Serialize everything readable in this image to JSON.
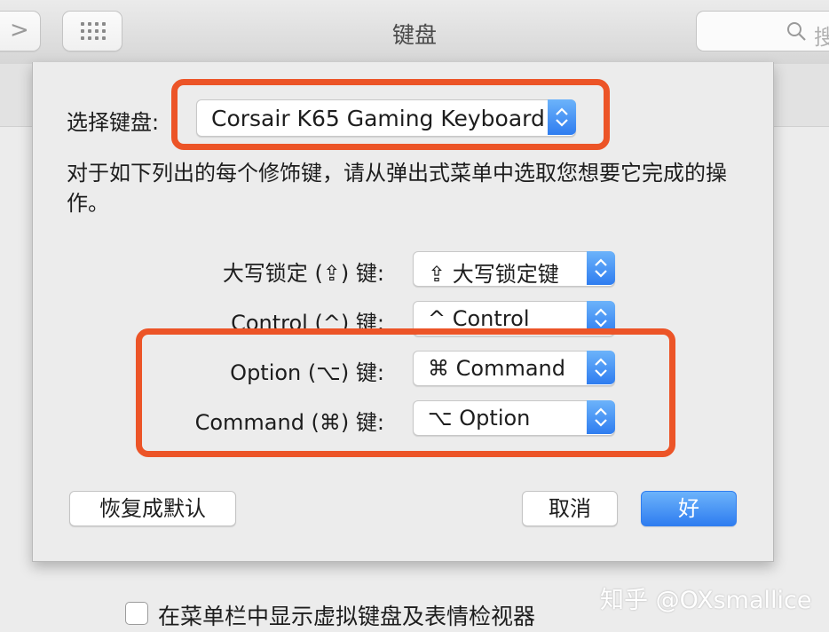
{
  "window": {
    "title": "键盘",
    "search_placeholder": "搜"
  },
  "sheet": {
    "keyboard_label": "选择键盘:",
    "keyboard_value": "Corsair K65 Gaming Keyboard",
    "description": "对于如下列出的每个修饰键，请从弹出式菜单中选取您想要它完成的操作。",
    "modifiers": [
      {
        "label": "大写锁定 (⇪) 键:",
        "value": "⇪ 大写锁定键"
      },
      {
        "label": "Control (^) 键:",
        "value": "^ Control"
      },
      {
        "label": "Option (⌥) 键:",
        "value": "⌘ Command"
      },
      {
        "label": "Command (⌘) 键:",
        "value": "⌥ Option"
      }
    ],
    "restore_button": "恢复成默认",
    "cancel_button": "取消",
    "ok_button": "好"
  },
  "footer": {
    "checkbox_label": "在菜单栏中显示虚拟键盘及表情检视器",
    "checkbox_checked": false
  },
  "watermark": "知乎 @OXsmallice",
  "colors": {
    "highlight": "#ec5427",
    "accent": "#2f7df0"
  }
}
